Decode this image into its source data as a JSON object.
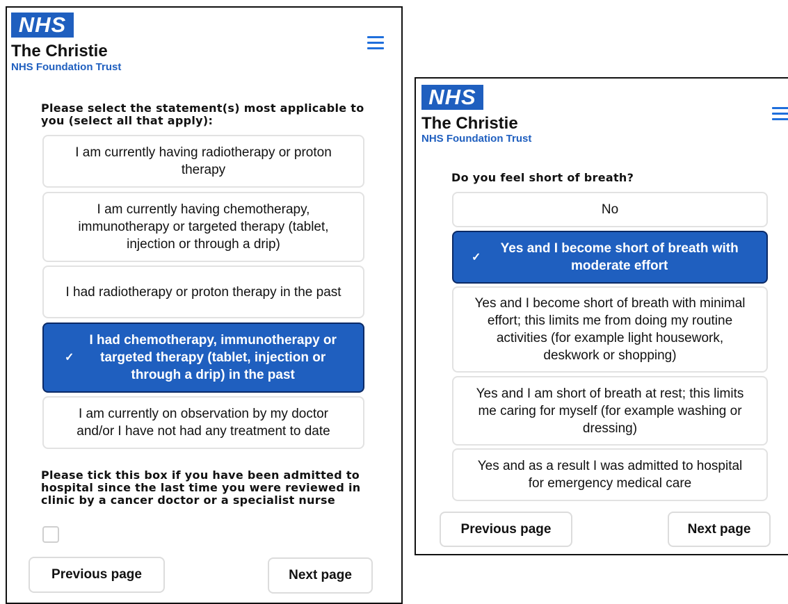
{
  "screen1": {
    "logo": {
      "text": "NHS"
    },
    "org": {
      "name": "The Christie",
      "sub": "NHS Foundation Trust"
    },
    "menu_icon": "hamburger-menu-icon",
    "question": "Please select the statement(s) most applicable to you (select all that apply):",
    "options": [
      {
        "label": "I am currently having radiotherapy or proton therapy",
        "selected": false
      },
      {
        "label": "I am currently having chemotherapy, immunotherapy or targeted therapy (tablet, injection or through a drip)",
        "selected": false
      },
      {
        "label": "I had radiotherapy or proton therapy in the past",
        "selected": false
      },
      {
        "label": "I had chemotherapy, immunotherapy or targeted therapy (tablet, injection or through a drip) in the past",
        "selected": true
      },
      {
        "label": "I am currently on observation by my doctor and/or I have not had any treatment to date",
        "selected": false
      }
    ],
    "tick_question": "Please tick this box if you have been admitted to hospital since the last time you were reviewed in clinic by a cancer doctor or a specialist nurse",
    "tick_checked": false,
    "prev_label": "Previous page",
    "next_label": "Next page"
  },
  "screen2": {
    "logo": {
      "text": "NHS"
    },
    "org": {
      "name": "The Christie",
      "sub": "NHS Foundation Trust"
    },
    "menu_icon": "hamburger-menu-icon",
    "question": "Do you feel short of breath?",
    "options": [
      {
        "label": "No",
        "selected": false
      },
      {
        "label": "Yes and I become short of breath with moderate effort",
        "selected": true
      },
      {
        "label": "Yes and I become short of breath with minimal effort; this limits me from doing my routine activities (for example light housework, deskwork or shopping)",
        "selected": false
      },
      {
        "label": "Yes and I am short of breath at rest; this limits me caring for myself (for example washing or dressing)",
        "selected": false
      },
      {
        "label": "Yes and as a result I was admitted to hospital for emergency medical care",
        "selected": false
      }
    ],
    "prev_label": "Previous page",
    "next_label": "Next page"
  },
  "colors": {
    "nhs_blue": "#1f5fbf",
    "selected_border": "#0b2a66",
    "menu_blue": "#1f6fdc"
  },
  "check_glyph": "✓"
}
